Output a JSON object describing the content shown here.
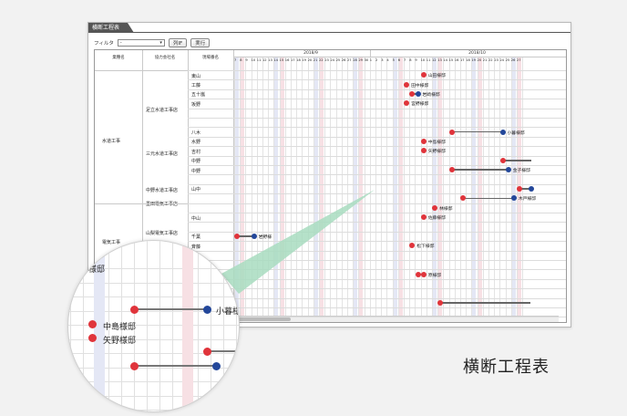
{
  "window": {
    "tab_title": "横断工程表"
  },
  "toolbar": {
    "filter_label": "フィルタ",
    "filter_value": "-",
    "column_button": "列IF",
    "run_button": "実行"
  },
  "table": {
    "headers": [
      "業種名",
      "協力会社名",
      "現場番名"
    ],
    "months": [
      "2018/9",
      "2018/10"
    ],
    "day_numbers_a": [
      "7",
      "8",
      "9",
      "10",
      "11",
      "12",
      "13",
      "14",
      "15",
      "16",
      "17",
      "18",
      "19",
      "20",
      "21",
      "22",
      "23",
      "24",
      "25",
      "26",
      "27",
      "28",
      "29",
      "30"
    ],
    "day_numbers_b": [
      "1",
      "2",
      "3",
      "4",
      "5",
      "6",
      "7",
      "8",
      "9",
      "10",
      "11",
      "12",
      "13",
      "14",
      "15",
      "16",
      "17",
      "18",
      "19",
      "20",
      "21",
      "22",
      "23",
      "24",
      "25",
      "26",
      "27"
    ],
    "trades": [
      "水道工事",
      "電気工事"
    ],
    "companies": [
      "足立水道工事店",
      "三元水道工事店",
      "中野水道工事店",
      "墨田電気工事店",
      "山梨電気工事店"
    ],
    "sites": [
      "東山",
      "工藤",
      "五十嵐",
      "坂野",
      "",
      "",
      "八木",
      "水野",
      "吉村",
      "中野",
      "中野",
      "",
      "山中",
      "",
      "",
      "中山",
      "",
      "千葉",
      "斉藤",
      "",
      "",
      "",
      "",
      "",
      "",
      "",
      ""
    ]
  },
  "bars": [
    {
      "label": "山田様邸"
    },
    {
      "label": "田中様邸"
    },
    {
      "label": "岩崎様邸"
    },
    {
      "label": "宮野様邸"
    },
    {
      "label": "小暮様邸"
    },
    {
      "label": "中島様邸"
    },
    {
      "label": "矢野様邸"
    },
    {
      "label": "金子様邸"
    },
    {
      "label": "木戸様邸"
    },
    {
      "label": "林様邸"
    },
    {
      "label": "佐藤様邸"
    },
    {
      "label": "岩野様"
    },
    {
      "label": "松下様邸"
    },
    {
      "label": "原様邸"
    }
  ],
  "magnifier": {
    "top_label": "岩崎様邸",
    "label2": "宮野様邸",
    "label_a": "小暮様邸",
    "label_b": "中島様邸",
    "label_c": "矢野様邸"
  },
  "caption": "横断工程表",
  "colors": {
    "red_dot": "#e0343b",
    "blue_dot": "#23479a",
    "beam": "#a8dcc0"
  }
}
